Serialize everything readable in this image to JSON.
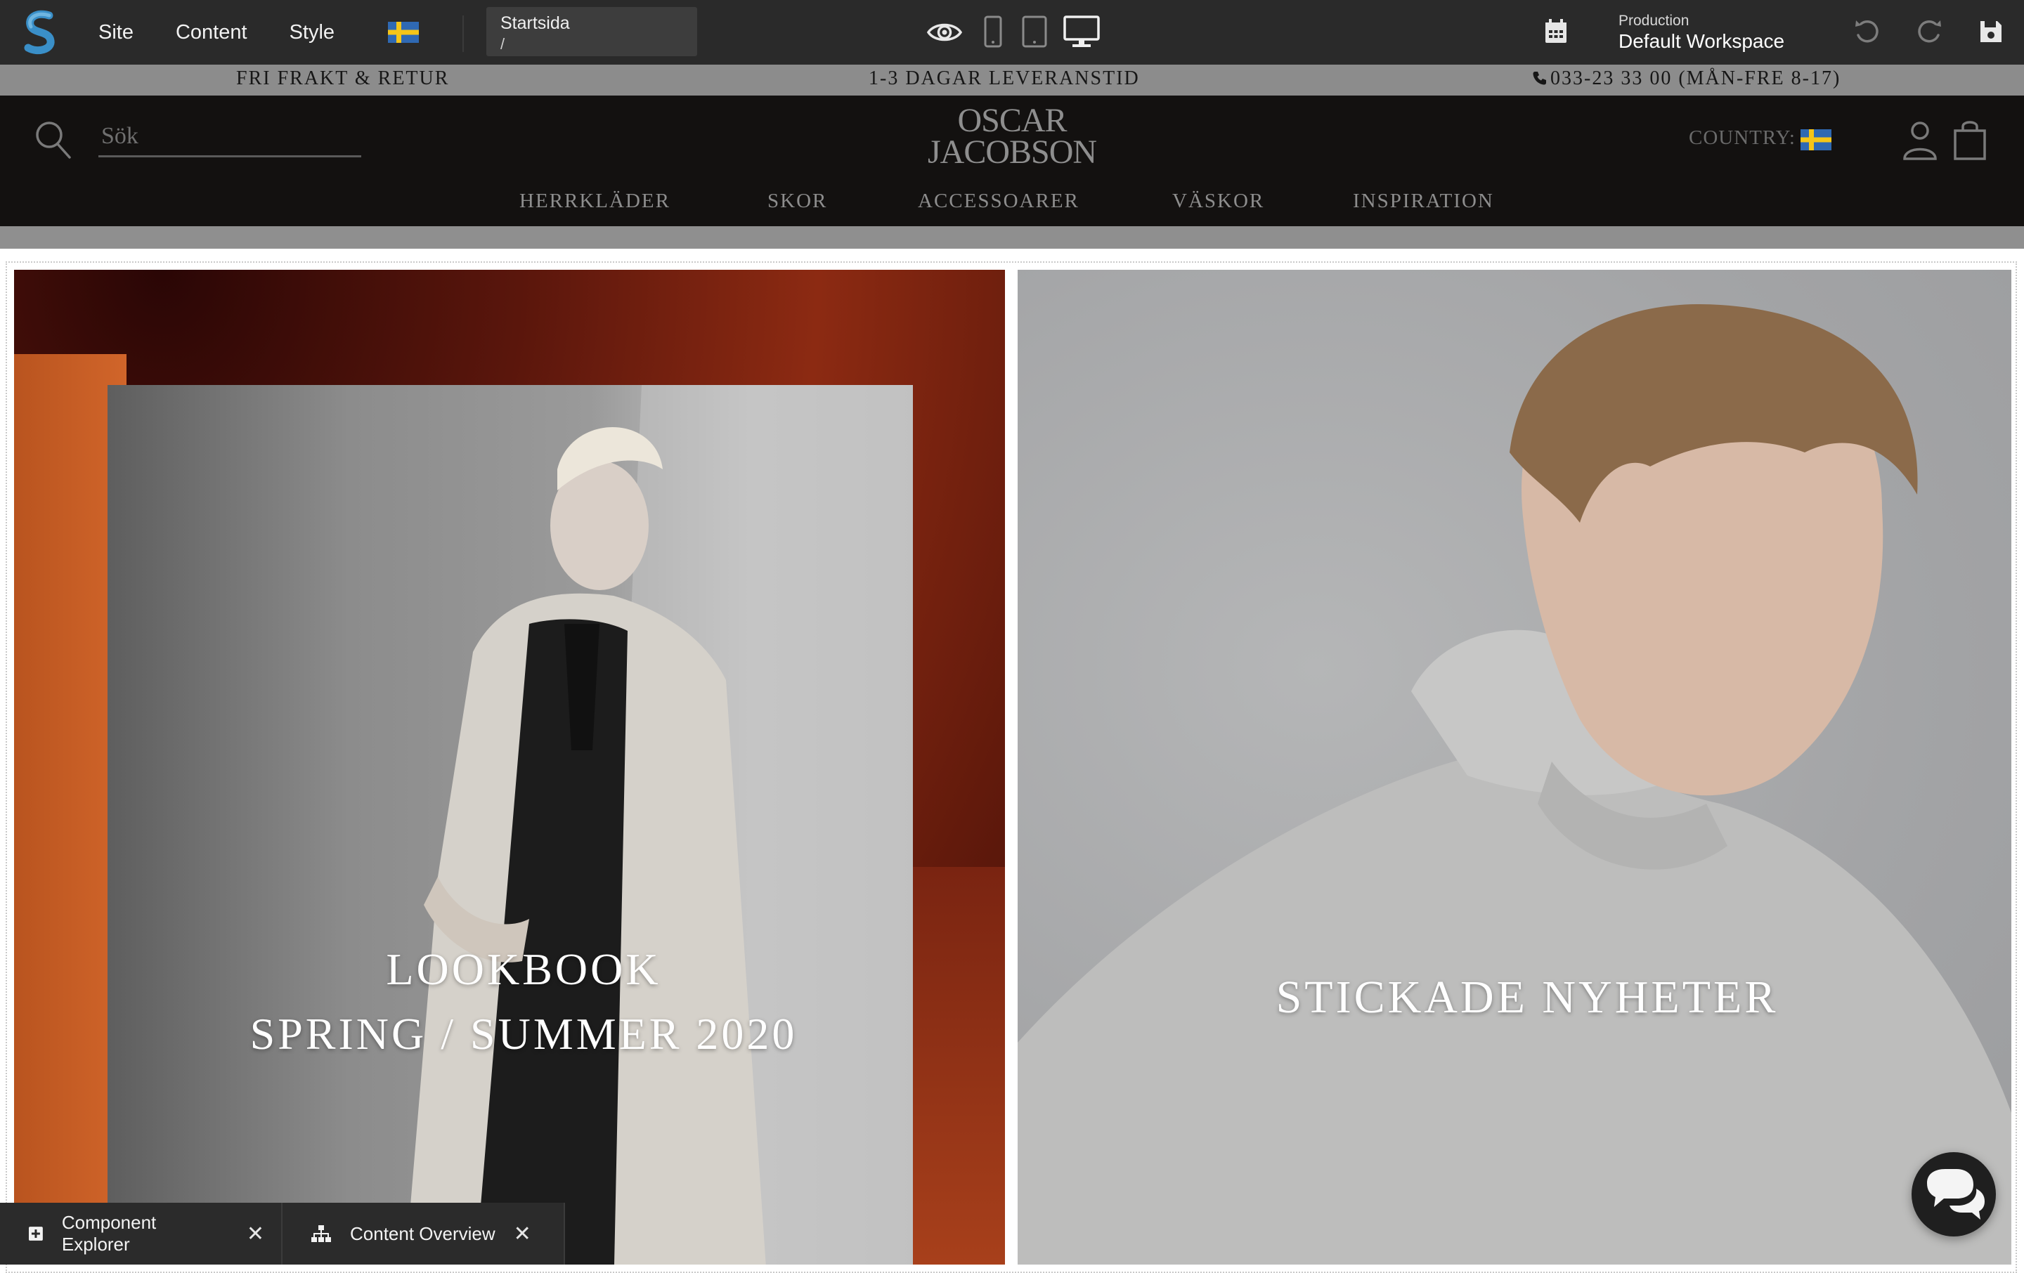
{
  "cms": {
    "menu": [
      "Site",
      "Content",
      "Style"
    ],
    "locale_flag": "sweden-flag",
    "page": {
      "name": "Startsida",
      "path": "/"
    },
    "devices": [
      "preview-eye-icon",
      "phone-icon",
      "tablet-icon",
      "desktop-icon"
    ],
    "workspace": {
      "environment": "Production",
      "name": "Default Workspace"
    }
  },
  "announcement": {
    "free_shipping": "FRI FRAKT & RETUR",
    "delivery": "1-3 DAGAR LEVERANSTID",
    "phone": "033-23 33 00 (MÅN-FRE 8-17)"
  },
  "header": {
    "search_placeholder": "Sök",
    "brand_line1": "OSCAR",
    "brand_line2": "JACOBSON",
    "country_label": "COUNTRY:",
    "nav": [
      "HERRKLÄDER",
      "SKOR",
      "ACCESSOARER",
      "VÄSKOR",
      "INSPIRATION"
    ]
  },
  "tiles": {
    "left": {
      "line1": "LOOKBOOK",
      "line2": "SPRING / SUMMER 2020"
    },
    "right": {
      "title": "STICKADE NYHETER"
    }
  },
  "panels": {
    "component_explorer": "Component Explorer",
    "content_overview": "Content Overview"
  },
  "colors": {
    "cms_bar": "#2a2a2a",
    "announcement": "#8c8c8c",
    "site_header": "#131110",
    "logo_blue": "#3a8fc8"
  }
}
